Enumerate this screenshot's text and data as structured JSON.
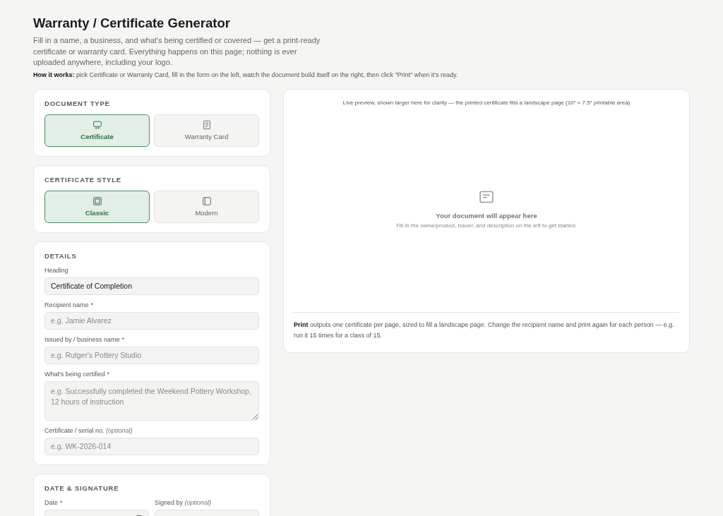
{
  "header": {
    "title": "Warranty / Certificate Generator",
    "description": "Fill in a name, a business, and what's being certified or covered — get a print-ready certificate or warranty card. Everything happens on this page; nothing is ever uploaded anywhere, including your logo.",
    "how_it_works": "**How it works:** pick Certificate or Warranty Card, fill in the form on the left, watch the document build itself on the right, then click \"Print\" when it's ready."
  },
  "panels": [
    {
      "kind": "choice",
      "title": "DOCUMENT TYPE",
      "options": [
        {
          "label": "Certificate",
          "selected": true
        },
        {
          "label": "Warranty Card",
          "selected": false
        }
      ]
    },
    {
      "kind": "choice",
      "title": "CERTIFICATE STYLE",
      "options": [
        {
          "label": "Classic",
          "selected": true
        },
        {
          "label": "Modern",
          "selected": false
        }
      ]
    },
    {
      "kind": "form",
      "title": "DETAILS",
      "fields": [
        {
          "kind": "text",
          "label": "Heading",
          "value": "Certificate of Completion"
        },
        {
          "kind": "text",
          "label": "Recipient name",
          "mark": "*",
          "placeholder": "e.g. Jamie Alvarez"
        },
        {
          "kind": "text",
          "label": "Issued by / business name",
          "mark": "*",
          "placeholder": "e.g. Rutger's Pottery Studio"
        },
        {
          "kind": "textarea",
          "label": "What's being certified",
          "mark": "*",
          "placeholder": "e.g. Successfully completed the Weekend Pottery Workshop, 12 hours of instruction"
        },
        {
          "kind": "text",
          "label": "Certificate / serial no. *(optional)*",
          "placeholder": "e.g. WK-2026-014"
        }
      ]
    },
    {
      "kind": "pair",
      "title": "DATE & SIGNATURE",
      "fields": [
        {
          "kind": "date",
          "label": "Date",
          "mark": "*"
        },
        {
          "kind": "text",
          "label": "Signed by *(optional)*"
        }
      ]
    }
  ],
  "preview": {
    "caption": "Live preview, shown larger here for clarity — the printed certificate fills a landscape page (10″ × 7.5″ printable area)",
    "empty_title": "Your document will appear here",
    "empty_hint": "Fill in the name/product, issuer, and description on the left to get started.",
    "note": "**Print** outputs one certificate per page, sized to fill a landscape page. Change the recipient name and print again for each person — e.g. run it 15 times for a class of 15."
  }
}
